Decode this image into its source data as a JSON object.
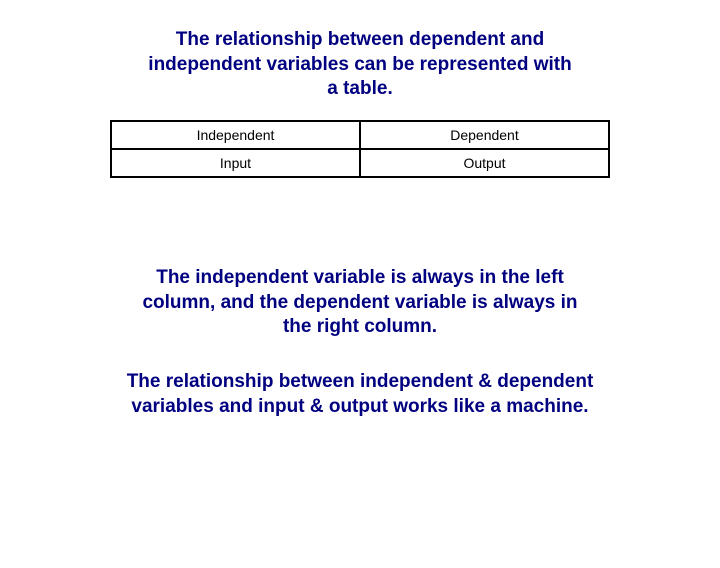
{
  "heading": "The relationship between dependent and independent variables can be represented with a table.",
  "table": {
    "row1": {
      "left": "Independent",
      "right": "Dependent"
    },
    "row2": {
      "left": "Input",
      "right": "Output"
    }
  },
  "para1": "The independent variable is always in the left column, and the dependent variable is always in the right column.",
  "para2": "The relationship between independent & dependent variables and input & output works like a machine."
}
